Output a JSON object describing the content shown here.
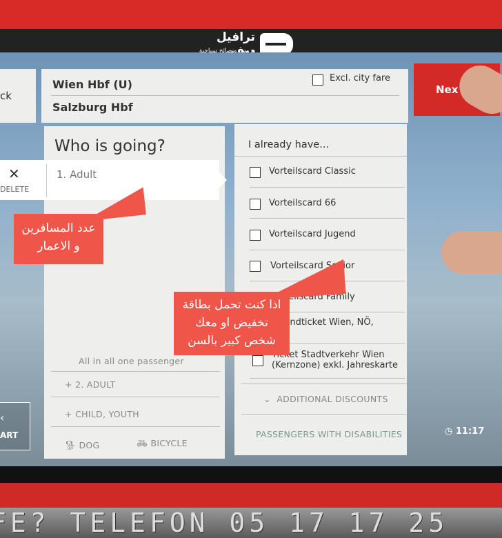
{
  "logo": {
    "title": "ترافيل ديف",
    "subtitle": "دروس ونصائح سياحية"
  },
  "back_label": "ck",
  "route": {
    "from": "Wien Hbf (U)",
    "to": "Salzburg Hbf",
    "excl_city_fare": "Excl. city fare",
    "excl_checked": false
  },
  "next_label": "Nex",
  "who": {
    "title": "Who is going?",
    "passenger": "1. Adult",
    "delete": "DELETE",
    "summary": "All in all one passenger",
    "add_adult": "2. ADULT",
    "add_child": "CHILD, YOUTH",
    "dog": "DOG",
    "bicycle": "BICYCLE"
  },
  "have": {
    "title": "I already have...",
    "items": [
      "Vorteilscard Classic",
      "Vorteilscard 66",
      "Vorteilscard Jugend",
      "Vorteilscard Senior",
      "Vorteilscard Family",
      "Jugendticket Wien, NÖ,",
      "Ticket Stadtverkehr Wien",
      "(Kernzone) exkl. Jahreskarte"
    ],
    "additional": "ADDITIONAL DISCOUNTS",
    "disabilities": "PASSENGERS WITH DISABILITIES"
  },
  "restart_label": "ART",
  "clock": "11:17",
  "annotations": {
    "a1": [
      "عدد المسافرين",
      "و الاعمار"
    ],
    "a2": [
      "اذا كنت تحمل بطاقة",
      "تخفيض او معك",
      "شخص كبير بالسن"
    ]
  },
  "plate_text": "FE? TELEFON 05 17 17 25",
  "colors": {
    "red": "#d82a26",
    "accent_green": "#7a9a8a"
  }
}
